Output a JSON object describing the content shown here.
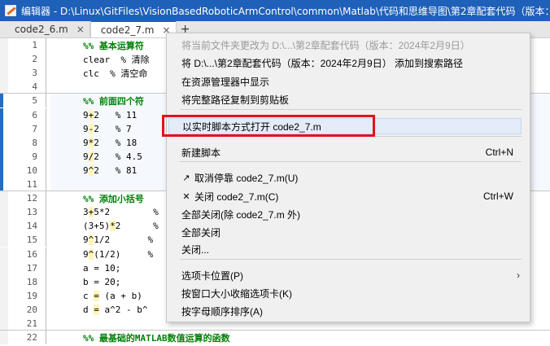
{
  "window": {
    "title": "编辑器 - D:\\Linux\\GitFiles\\VisionBasedRoboticArmControl\\common\\Matlab\\代码和思维导图\\第2章配套代码（版本："
  },
  "tabs": [
    {
      "label": "code2_6.m",
      "close": "×"
    },
    {
      "label": "code2_7.m",
      "close": "×"
    }
  ],
  "tab_add": "+",
  "editor": {
    "lines": [
      {
        "n": "1",
        "text": "%% 基本运算符",
        "comment": true
      },
      {
        "n": "2",
        "text": "clear  % 清除",
        "comment": false
      },
      {
        "n": "3",
        "text": "clc  % 清空命",
        "comment": false
      },
      {
        "n": "4",
        "text": "",
        "comment": false
      },
      {
        "n": "5",
        "text": "%% 前面四个符",
        "comment": true
      },
      {
        "n": "6",
        "pre": "9",
        "op": "+",
        "post": "2   % 11"
      },
      {
        "n": "7",
        "pre": "9",
        "op": "-",
        "post": "2   % 7"
      },
      {
        "n": "8",
        "pre": "9",
        "op": "*",
        "post": "2   % 18"
      },
      {
        "n": "9",
        "pre": "9",
        "op": "/",
        "post": "2   % 4.5"
      },
      {
        "n": "10",
        "pre": "9",
        "op": "^",
        "post": "2   % 81"
      },
      {
        "n": "11",
        "text": "",
        "comment": false
      },
      {
        "n": "12",
        "text": "%% 添加小括号",
        "comment": true
      },
      {
        "n": "13",
        "pre": "3",
        "op": "+",
        "post": "5*2        %"
      },
      {
        "n": "14",
        "pre": "(3+5)",
        "op": "*",
        "post": "2      %"
      },
      {
        "n": "15",
        "pre": "9",
        "op": "^",
        "post": "1/2       %"
      },
      {
        "n": "16",
        "pre": "9",
        "op": "^",
        "post": "(1/2)     %"
      },
      {
        "n": "17",
        "text": "a = 10;",
        "comment": false
      },
      {
        "n": "18",
        "text": "b = 20;",
        "comment": false
      },
      {
        "n": "19",
        "pre": "c ",
        "op": "=",
        "post": " (a + b)"
      },
      {
        "n": "20",
        "pre": "d ",
        "op": "=",
        "post": " a^2 - b^"
      },
      {
        "n": "21",
        "text": "",
        "comment": false
      },
      {
        "n": "22",
        "text": "%% 最基础的MATLAB数值运算的函数",
        "comment": true
      }
    ]
  },
  "context_menu": {
    "items": [
      {
        "label": "将当前文件夹更改为 D:\\...\\第2章配套代码（版本：2024年2月9日）",
        "disabled": true
      },
      {
        "label": "将 D:\\...\\第2章配套代码（版本：2024年2月9日） 添加到搜索路径"
      },
      {
        "label": "在资源管理器中显示"
      },
      {
        "label": "将完整路径复制到剪贴板"
      },
      {
        "label": "以实时脚本方式打开 code2_7.m"
      },
      {
        "label": "新建脚本",
        "shortcut": "Ctrl+N"
      },
      {
        "label": "取消停靠 code2_7.m(U)",
        "icon": "↗"
      },
      {
        "label": "关闭 code2_7.m(C)",
        "icon": "✕",
        "shortcut": "Ctrl+W"
      },
      {
        "label": "全部关闭(除 code2_7.m 外)"
      },
      {
        "label": "全部关闭"
      },
      {
        "label": "关闭..."
      },
      {
        "label": "选项卡位置(P)",
        "arrow": "›"
      },
      {
        "label": "按窗口大小收缩选项卡(K)"
      },
      {
        "label": "按字母顺序排序(A)"
      }
    ]
  },
  "colors": {
    "titlebar": "#1f60b8",
    "comment": "#028009",
    "highlight_box": "#e3131b"
  }
}
